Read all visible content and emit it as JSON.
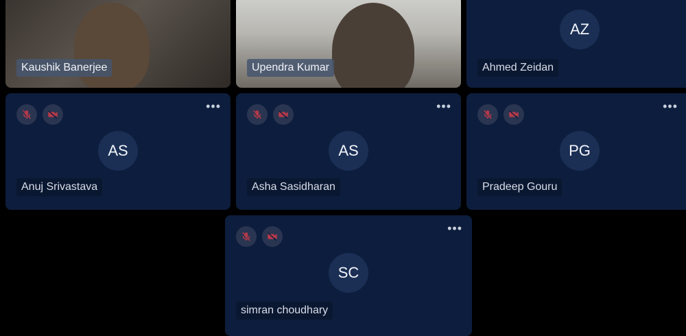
{
  "participants": [
    {
      "name": "Kaushik Banerjee"
    },
    {
      "name": "Upendra Kumar"
    },
    {
      "name": "Ahmed Zeidan",
      "initials": "AZ"
    },
    {
      "name": "Anuj Srivastava",
      "initials": "AS"
    },
    {
      "name": "Asha Sasidharan",
      "initials": "AS"
    },
    {
      "name": "Pradeep Gouru",
      "initials": "PG"
    },
    {
      "name": "simran choudhary",
      "initials": "SC"
    }
  ],
  "icons": {
    "muted_mic": "mic-off-icon",
    "video_off": "video-off-icon",
    "more": "more-options-icon"
  },
  "colors": {
    "tile_bg": "#0d1d3d",
    "avatar_bg": "#1b2f55",
    "muted_icon": "#b43a4a"
  }
}
